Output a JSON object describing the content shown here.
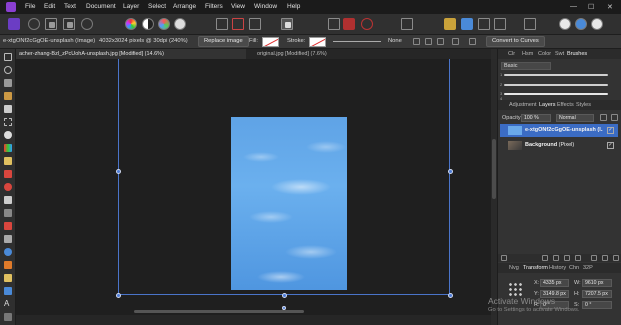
{
  "menu": {
    "items": [
      "File",
      "Edit",
      "Text",
      "Document",
      "Layer",
      "Select",
      "Arrange",
      "Filters",
      "View",
      "Window",
      "Help"
    ],
    "window_controls": [
      "—",
      "☐",
      "✕"
    ]
  },
  "context_bar": {
    "layer_name": "e-xtgONf2cGgOE-unsplash (Image)",
    "image_info": "4032x3024 pixels @ 30dpi (240%)",
    "replace_image_label": "Replace image",
    "fill_label": "Fill:",
    "stroke_label": "Stroke:",
    "stroke_style": "None",
    "convert_label": "Convert to Curves"
  },
  "tabs": [
    {
      "label": "acher-zhang-Bzl_zPcUohA-unsplash.jpg [Modified] (14.6%)",
      "active": true
    },
    {
      "label": "original.jpg [Modified] (7.6%)",
      "active": false
    }
  ],
  "panel": {
    "top_tabs": [
      "Clr",
      "Hsm",
      "Color",
      "Swt",
      "Brushes"
    ],
    "brush_category": "Basic",
    "brush_sizes": [
      "1",
      "2",
      "3",
      "4"
    ],
    "mid_tabs": [
      "Adjustment",
      "Layers",
      "Effects",
      "Styles"
    ],
    "opacity_label": "Opacity:",
    "opacity_value": "100 %",
    "blend_mode": "Normal",
    "layers": [
      {
        "name": "e-xtgONf2cGgOE-unsplash (I...",
        "selected": true,
        "check": "✓"
      },
      {
        "name": "Background",
        "suffix": "(Pixel)",
        "selected": false,
        "check": "✓"
      }
    ],
    "bottom_tabs": [
      "Nvg",
      "Transform",
      "History",
      "Chn",
      "32P"
    ],
    "transform": {
      "x_label": "X:",
      "x_value": "4335 px",
      "y_label": "Y:",
      "y_value": "3149.8 px",
      "w_label": "W:",
      "w_value": "9610 px",
      "h_label": "H:",
      "h_value": "7207.5 px",
      "r_label": "R:",
      "r_value": "0 °",
      "s_label": "S:",
      "s_value": "0 °"
    }
  },
  "watermark": {
    "line1": "Activate Windows",
    "line2": "Go to Settings to activate Windows."
  },
  "colors": {
    "accent": "#6b3dc4",
    "selection": "#4a74c9",
    "sky": "#5fa3e6"
  }
}
